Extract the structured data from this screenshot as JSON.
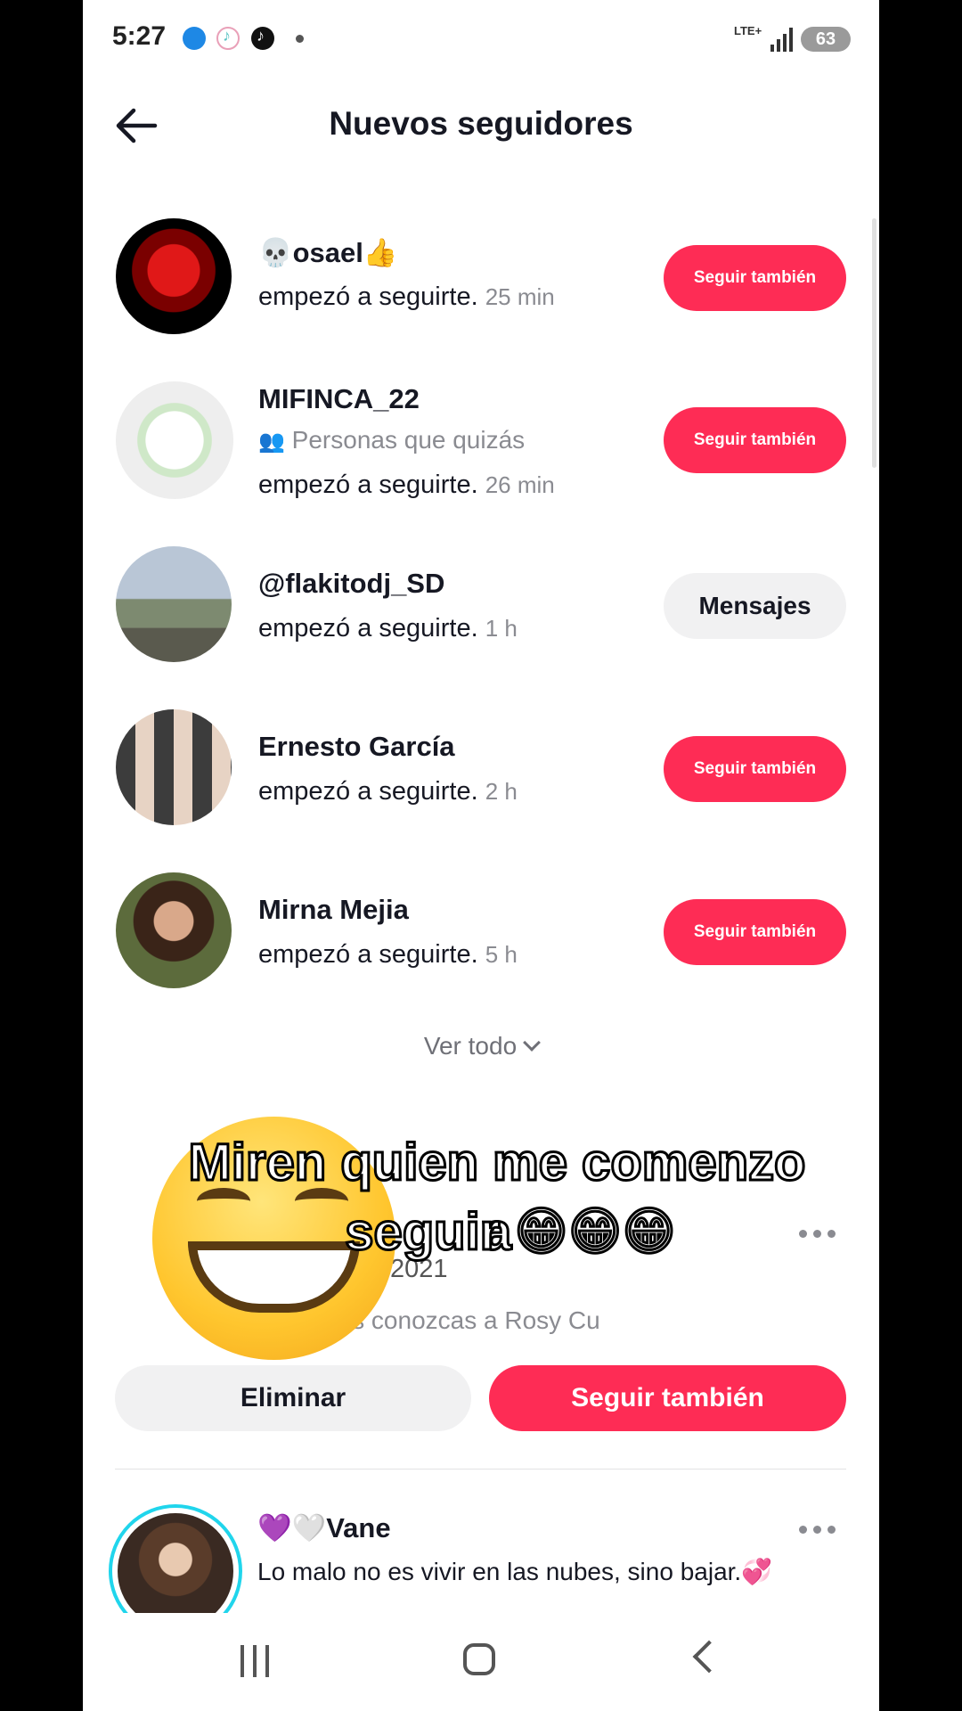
{
  "status_bar": {
    "time": "5:27",
    "network": "LTE+",
    "battery": "63"
  },
  "header": {
    "title": "Nuevos seguidores"
  },
  "followers": [
    {
      "username": "💀osael👍",
      "action": "empezó a seguirte.",
      "ago": "25 min",
      "button": "Seguir también",
      "button_type": "follow"
    },
    {
      "username": "MIFINCA_22",
      "hint": "Personas que quizás",
      "action": "empezó a seguirte.",
      "ago": "26 min",
      "button": "Seguir también",
      "button_type": "follow"
    },
    {
      "username": "@flakitodj_SD",
      "action": "empezó a seguirte.",
      "ago": "1 h",
      "button": "Mensajes",
      "button_type": "message"
    },
    {
      "username": "Ernesto García",
      "action": "empezó a seguirte.",
      "ago": "2 h",
      "button": "Seguir también",
      "button_type": "follow"
    },
    {
      "username": "Mirna Mejia",
      "action": "empezó a seguirte.",
      "ago": "5 h",
      "button": "Seguir también",
      "button_type": "follow"
    }
  ],
  "see_all": "Ver todo",
  "suggestion": {
    "username_partial": "onilla972021",
    "hint": "Quizás conozcas a Rosy Cu",
    "remove_label": "Eliminar",
    "follow_label": "Seguir también"
  },
  "next_user": {
    "name": "💜🤍Vane",
    "bio": "Lo malo no es vivir en las nubes, sino bajar.💞"
  },
  "overlay": {
    "caption_line1": "Miren quien me comenzo a",
    "caption_line2": "seguir 😁😁😁"
  },
  "colors": {
    "accent": "#fe2c55",
    "secondary_button": "#f1f1f2",
    "ring": "#20d5ec"
  }
}
